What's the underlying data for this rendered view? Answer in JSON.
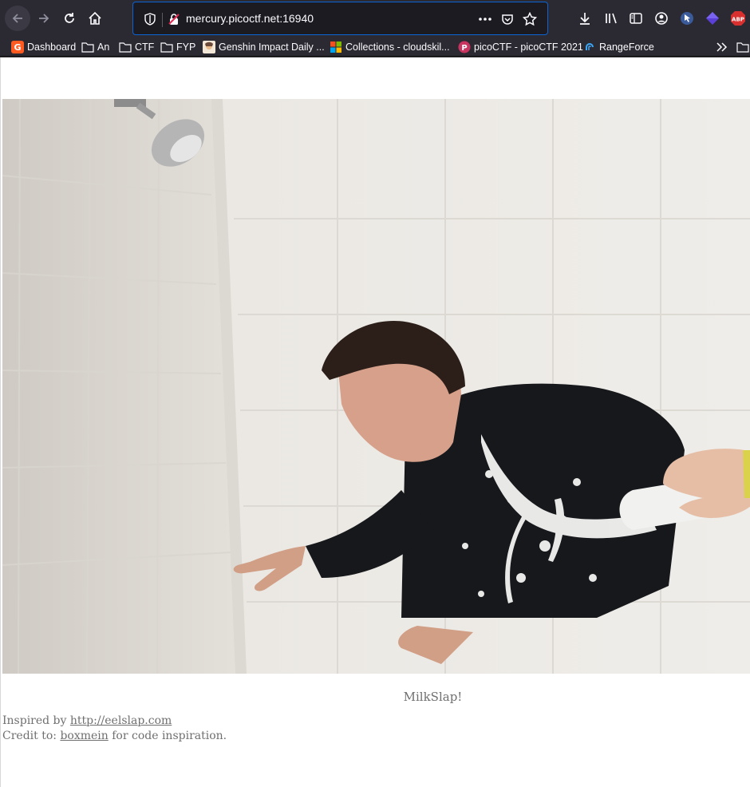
{
  "browser": {
    "url": "mercury.picoctf.net:16940",
    "bookmarks": [
      {
        "label": "Dashboard",
        "icon": "g2-logo-icon"
      },
      {
        "label": "An",
        "icon": "folder-icon"
      },
      {
        "label": "CTF",
        "icon": "folder-icon"
      },
      {
        "label": "FYP",
        "icon": "folder-icon"
      },
      {
        "label": "Genshin Impact Daily ...",
        "icon": "genshin-favicon-icon"
      },
      {
        "label": "Collections - cloudskil...",
        "icon": "microsoft-logo-icon"
      },
      {
        "label": "picoCTF - picoCTF 2021",
        "icon": "picoctf-favicon-icon"
      },
      {
        "label": "RangeForce",
        "icon": "rangeforce-favicon-icon"
      }
    ],
    "extension_abp": "ABP",
    "accent": "#0b63d4"
  },
  "page": {
    "caption": "MilkSlap!",
    "inspired_prefix": "Inspired by ",
    "inspired_link": "http://eelslap.com",
    "credit_prefix": "Credit to: ",
    "credit_link": "boxmein",
    "credit_suffix": " for code inspiration."
  }
}
